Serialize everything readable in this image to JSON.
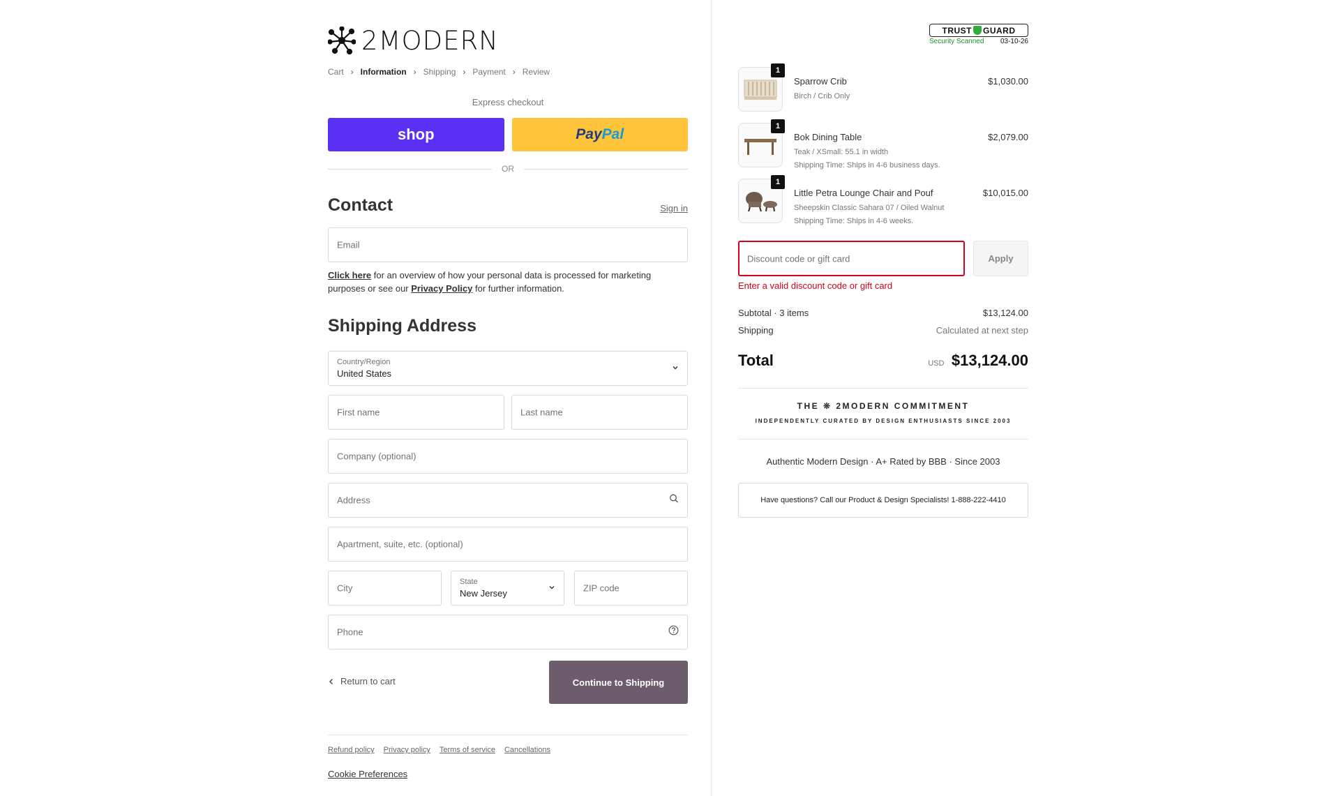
{
  "brand": {
    "logo_text": "2MODERN"
  },
  "breadcrumb": [
    "Cart",
    "Information",
    "Shipping",
    "Payment",
    "Review"
  ],
  "express": {
    "label": "Express checkout",
    "shop_label": "shop",
    "paypal_label_1": "Pay",
    "paypal_label_2": "Pal",
    "or_label": "OR"
  },
  "contact": {
    "heading": "Contact",
    "sign_in": "Sign in",
    "email_placeholder": "Email",
    "privacy_link": "Click here",
    "privacy_text_1": " for an overview of how your personal data is processed for marketing purposes or see our ",
    "privacy_policy_link": "Privacy Policy",
    "privacy_text_2": " for further information."
  },
  "shipping": {
    "heading": "Shipping Address",
    "country_label": "Country/Region",
    "country_value": "United States",
    "first_name": "First name",
    "last_name": "Last name",
    "company": "Company (optional)",
    "address": "Address",
    "apartment": "Apartment, suite, etc. (optional)",
    "city": "City",
    "state_label": "State",
    "state_value": "New Jersey",
    "zip": "ZIP code",
    "phone": "Phone"
  },
  "actions": {
    "return_label": "Return to cart",
    "continue_label": "Continue to Shipping"
  },
  "footer": {
    "links": [
      "Refund policy",
      "Privacy policy",
      "Terms of service",
      "Cancellations"
    ],
    "cookie": "Cookie Preferences"
  },
  "trust_badge": {
    "title": "TRUST",
    "title2": "GUARD",
    "scanned": "Security Scanned",
    "date": "03-10-26"
  },
  "cart": {
    "items": [
      {
        "qty": "1",
        "name": "Sparrow Crib",
        "variant": "Birch / Crib Only",
        "note": "",
        "price": "$1,030.00"
      },
      {
        "qty": "1",
        "name": "Bok Dining Table",
        "variant": "Teak / XSmall: 55.1 in width",
        "note": "Shipping Time: Ships in 4-6 business days.",
        "price": "$2,079.00"
      },
      {
        "qty": "1",
        "name": "Little Petra Lounge Chair and Pouf",
        "variant": "Sheepskin Classic Sahara 07 / Oiled Walnut",
        "note": "Shipping Time: Ships in 4-6 weeks.",
        "price": "$10,015.00"
      }
    ],
    "discount_placeholder": "Discount code or gift card",
    "apply_label": "Apply",
    "discount_error": "Enter a valid discount code or gift card",
    "subtotal_label": "Subtotal · 3 items",
    "subtotal_value": "$13,124.00",
    "shipping_label": "Shipping",
    "shipping_value": "Calculated at next step",
    "total_label": "Total",
    "total_currency": "USD",
    "total_value": "$13,124.00"
  },
  "commitment": {
    "title": "THE ❊ 2MODERN COMMITMENT",
    "subtitle": "INDEPENDENTLY CURATED BY DESIGN ENTHUSIASTS SINCE 2003"
  },
  "authentic": "Authentic Modern Design · A+ Rated by BBB · Since 2003",
  "questions": "Have questions? Call our Product & Design Specialists! 1-888-222-4410",
  "colors": {
    "shop": "#5a31f4",
    "paypal": "#ffc43a",
    "continue": "#6c5c6c",
    "error": "#d0021b"
  }
}
